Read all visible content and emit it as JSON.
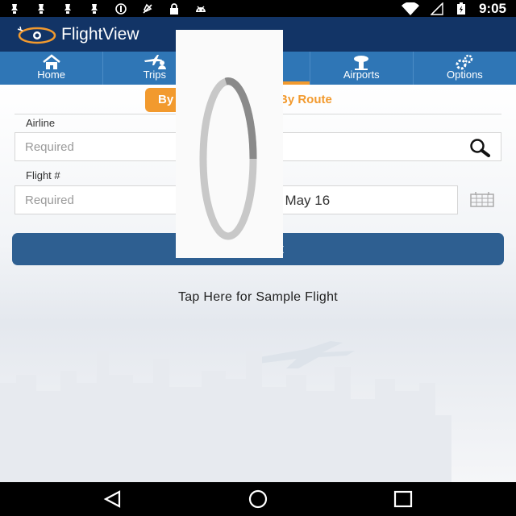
{
  "status_bar": {
    "time": "9:05",
    "left_icons": [
      "notification-icon",
      "notification-icon",
      "notification-icon",
      "notification-icon",
      "data-saver-icon",
      "location-off-icon",
      "lock-icon",
      "android-icon"
    ],
    "right_icons": [
      "wifi-icon",
      "signal-icon",
      "battery-charging-icon"
    ]
  },
  "app_bar": {
    "title": "FlightView",
    "brand_color": "#123466",
    "accent_color": "#f29a2e"
  },
  "tabs": [
    {
      "label": "Home",
      "icon": "home-icon"
    },
    {
      "label": "Trips",
      "icon": "trips-icon"
    },
    {
      "label": "",
      "icon": ""
    },
    {
      "label": "Airports",
      "icon": "airport-icon"
    },
    {
      "label": "Options",
      "icon": "gears-icon"
    }
  ],
  "search_mode": {
    "left_label": "By",
    "right_label": "By Route"
  },
  "form": {
    "airline_label": "Airline",
    "airline_placeholder": "Required",
    "flight_label": "Flight #",
    "flight_placeholder": "Required",
    "date_label": ",",
    "date_value": ", May 16",
    "submit_label": "ght"
  },
  "sample_link": "Tap Here for Sample Flight",
  "nav_bar": {
    "icons": [
      "back-icon",
      "home-circle-icon",
      "recents-icon"
    ]
  }
}
